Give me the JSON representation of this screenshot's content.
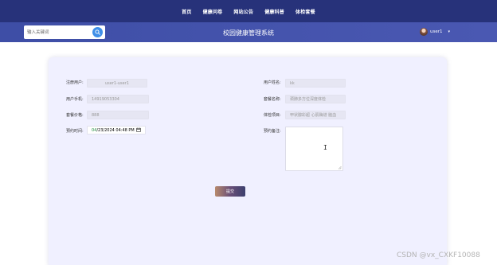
{
  "nav": {
    "items": [
      "首页",
      "健康问卷",
      "网站公告",
      "健康科普",
      "体检套餐"
    ]
  },
  "header": {
    "search_placeholder": "输入关键词",
    "site_title": "校园健康管理系统",
    "username": "user1"
  },
  "form": {
    "reg_user_label": "注册用户:",
    "reg_user_value": "user1-user1",
    "user_name_label": "用户姓名:",
    "user_name_value": "kk",
    "phone_label": "用户手机:",
    "phone_value": "14919053304",
    "package_name_label": "套餐名称:",
    "package_name_value": "颈肺多方位深度体检",
    "price_label": "套餐价格:",
    "price_value": "888",
    "exam_items_label": "体检项目:",
    "exam_items_value": "甲状腺彩超 心肌酶谱 脑血",
    "appt_time_label": "预约时间:",
    "appt_date_mm": "04",
    "appt_date_rest": "/23/2024 04:48 PM",
    "remark_label": "预约备注:",
    "submit_label": "提交"
  },
  "watermark": "CSDN @vx_CXKF10088",
  "colors": {
    "topnav": "#27327a",
    "subheader": "#4a58b2",
    "card_bg": "#f0f0ff",
    "search_button": "#3f8fe8"
  }
}
